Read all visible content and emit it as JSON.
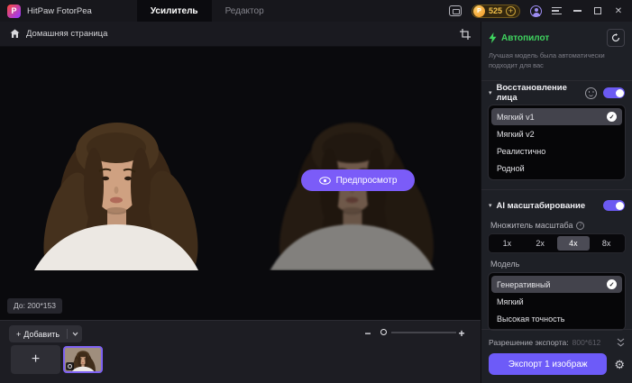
{
  "titlebar": {
    "app_title": "HitPaw FotorPea",
    "tabs": [
      {
        "label": "Усилитель",
        "active": true
      },
      {
        "label": "Редактор",
        "active": false
      }
    ],
    "credits": "525"
  },
  "navbar": {
    "home_label": "Домашняя страница"
  },
  "canvas": {
    "before_badge": "До: 200*153",
    "preview_button": "Предпросмотр"
  },
  "bottombar": {
    "add_button": "Добавить"
  },
  "sidebar": {
    "autopilot": {
      "title": "Автопилот",
      "description": "Лучшая модель была автоматически подходит для вас"
    },
    "face_restoration": {
      "title": "Восстановление лица",
      "enabled": true,
      "options": [
        {
          "label": "Мягкий v1",
          "selected": true
        },
        {
          "label": "Мягкий v2",
          "selected": false
        },
        {
          "label": "Реалистично",
          "selected": false
        },
        {
          "label": "Родной",
          "selected": false
        }
      ]
    },
    "ai_upscaling": {
      "title": "AI масштабирование",
      "enabled": true,
      "multiplier_label": "Множитель масштаба",
      "multipliers": [
        {
          "label": "1x",
          "active": false
        },
        {
          "label": "2x",
          "active": false
        },
        {
          "label": "4x",
          "active": true
        },
        {
          "label": "8x",
          "active": false
        }
      ],
      "model_label": "Модель",
      "models": [
        {
          "label": "Генеративный",
          "selected": true
        },
        {
          "label": "Мягкий",
          "selected": false
        },
        {
          "label": "Высокая точность",
          "selected": false
        }
      ]
    },
    "export": {
      "resolution_label": "Разрешение экспорта:",
      "resolution_value": "800*612",
      "button_label": "Экспорт 1 изображ"
    }
  },
  "glyphs": {
    "logo_p": "P",
    "coin_p": "P",
    "plus": "+",
    "minus": "−",
    "close": "✕",
    "caret_down": "▾",
    "check": "✓",
    "gear": "⚙",
    "info": "i"
  },
  "colors": {
    "accent_purple": "#7b5cf8",
    "toggle_purple": "#6b5af2",
    "autopilot_green": "#3fd45f",
    "credits_gold": "#f3c14a"
  }
}
